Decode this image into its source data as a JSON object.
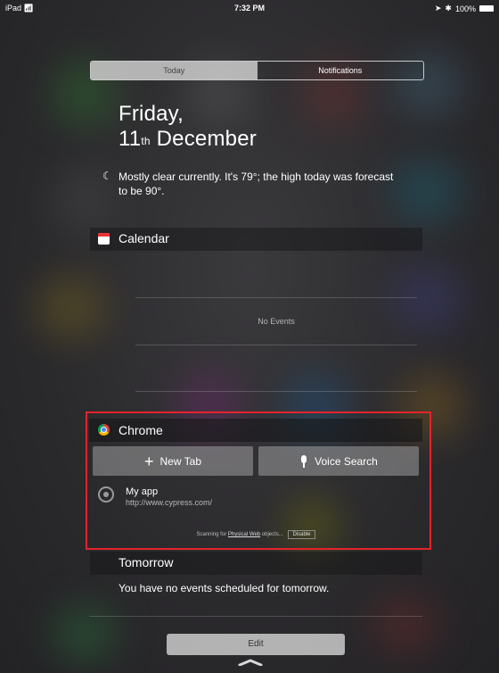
{
  "status_bar": {
    "device": "iPad",
    "wifi_icon": "wifi-icon",
    "time": "7:32 PM",
    "battery": "100%"
  },
  "segmented_control": {
    "tabs": [
      {
        "label": "Today",
        "selected": true
      },
      {
        "label": "Notifications",
        "selected": false
      }
    ]
  },
  "date": {
    "weekday": "Friday,",
    "day": "11",
    "ordinal_suffix": "th",
    "month": "December"
  },
  "weather": {
    "icon": "moon-icon",
    "text": "Mostly clear currently. It's 79°; the high today was forecast to be 90°."
  },
  "calendar": {
    "title": "Calendar",
    "icon": "calendar-icon",
    "empty_text": "No Events"
  },
  "chrome": {
    "title": "Chrome",
    "icon": "chrome-icon",
    "new_tab_label": "New Tab",
    "voice_search_label": "Voice Search",
    "physical_web_item": {
      "title": "My app",
      "url": "http://www.cypress.com/"
    },
    "scanning_prefix": "Scanning for",
    "scanning_link": "Physical Web",
    "scanning_suffix": "objects...",
    "disable_label": "Disable",
    "highlight_color": "#e3242b"
  },
  "tomorrow": {
    "title": "Tomorrow",
    "text": "You have no events scheduled for tomorrow."
  },
  "edit_button": {
    "label": "Edit"
  }
}
